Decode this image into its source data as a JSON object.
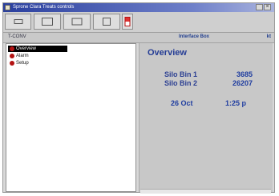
{
  "window": {
    "title": "Sprone Clara Treats controls"
  },
  "header": {
    "left_label": "T-CONV",
    "center_label": "Interface Box",
    "right_label": "kt"
  },
  "nav": {
    "items": [
      {
        "label": "Overview"
      },
      {
        "label": "Alarm"
      },
      {
        "label": "Setup"
      }
    ]
  },
  "overview": {
    "title": "Overview",
    "silo1_label": "Silo Bin 1",
    "silo1_value": "3685",
    "silo2_label": "Silo Bin 2",
    "silo2_value": "26207",
    "date_label": "26  Oct",
    "time_value": "1:25 p"
  },
  "colors": {
    "titlebar": "#2a3f9e",
    "selection": "#000000",
    "accent_text": "#243c95",
    "status_dot": "#b31313"
  },
  "icons": {
    "nav_item": "red-dot-icon",
    "toolbar": [
      "window-icon",
      "window-icon",
      "document-icon",
      "image-icon",
      "flag-icon"
    ]
  }
}
